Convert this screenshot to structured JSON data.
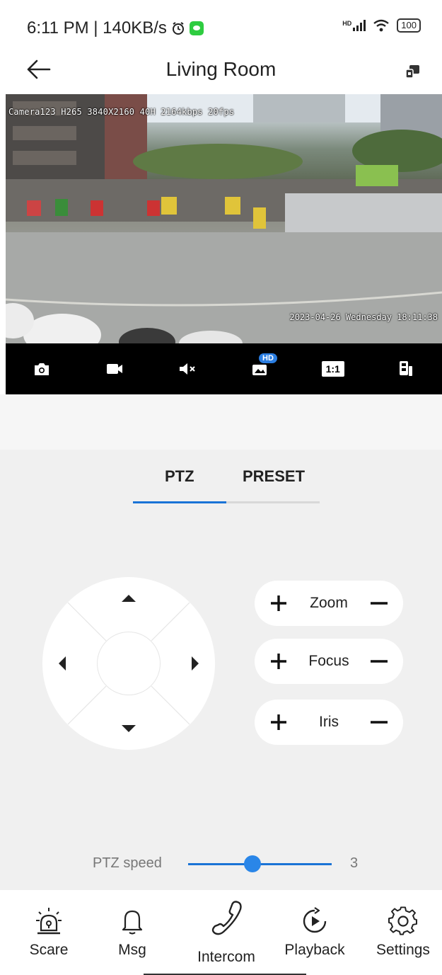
{
  "status_bar": {
    "time_network": "6:11 PM | 140KB/s",
    "signal_badge": "HD",
    "battery": "100",
    "icons": [
      "alarm-icon",
      "chat-app-icon",
      "signal-icon",
      "wifi-icon",
      "battery-icon"
    ]
  },
  "header": {
    "title": "Living Room",
    "back_icon": "arrow-left-icon",
    "cast_icon": "cast-device-icon"
  },
  "video": {
    "osd_top": "Camera123 H265 3840X2160 40H 2164kbps 20fps",
    "osd_bottom": "2023-04-26 Wednesday 18:11:38"
  },
  "toolbar": {
    "items": [
      {
        "icon": "snapshot-camera-icon"
      },
      {
        "icon": "record-video-icon"
      },
      {
        "icon": "mute-speaker-icon"
      },
      {
        "icon": "hd-quality-icon",
        "badge": "HD"
      },
      {
        "icon": "aspect-ratio-icon",
        "label": "1:1"
      },
      {
        "icon": "multi-screen-icon"
      }
    ]
  },
  "tabs": {
    "ptz": "PTZ",
    "preset": "PRESET",
    "active": "PTZ"
  },
  "controls": {
    "zoom": "Zoom",
    "focus": "Focus",
    "iris": "Iris"
  },
  "speed": {
    "label": "PTZ speed",
    "value": "3",
    "fraction": 0.45
  },
  "nav": {
    "scare": "Scare",
    "msg": "Msg",
    "intercom": "Intercom",
    "playback": "Playback",
    "settings": "Settings"
  },
  "colors": {
    "accent": "#1a73d6",
    "panel_bg": "#f0f0f0",
    "toolbar_bg": "#000000",
    "hd_badge": "#2a7de1"
  }
}
